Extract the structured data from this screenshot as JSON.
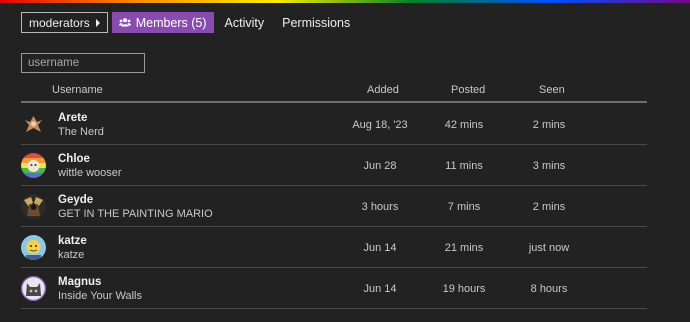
{
  "nav": {
    "group_dropdown": "moderators",
    "tabs": [
      {
        "label": "Members (5)",
        "active": true,
        "icon": "users-icon"
      },
      {
        "label": "Activity",
        "active": false
      },
      {
        "label": "Permissions",
        "active": false
      }
    ]
  },
  "filter": {
    "placeholder": "username",
    "value": ""
  },
  "table": {
    "headers": {
      "username": "Username",
      "added": "Added",
      "posted": "Posted",
      "seen": "Seen"
    },
    "rows": [
      {
        "username": "Arete",
        "title": "The Nerd",
        "added": "Aug 18, '23",
        "posted": "42 mins",
        "seen": "2 mins"
      },
      {
        "username": "Chloe",
        "title": "wittle wooser",
        "added": "Jun 28",
        "posted": "11 mins",
        "seen": "3 mins"
      },
      {
        "username": "Geyde",
        "title": "GET IN THE PAINTING MARIO",
        "added": "3 hours",
        "posted": "7 mins",
        "seen": "2 mins"
      },
      {
        "username": "katze",
        "title": "katze",
        "added": "Jun 14",
        "posted": "21 mins",
        "seen": "just now"
      },
      {
        "username": "Magnus",
        "title": "Inside Your Walls",
        "added": "Jun 14",
        "posted": "19 hours",
        "seen": "8 hours"
      }
    ]
  },
  "colors": {
    "accent": "#8a4bb1",
    "background": "#222222"
  }
}
